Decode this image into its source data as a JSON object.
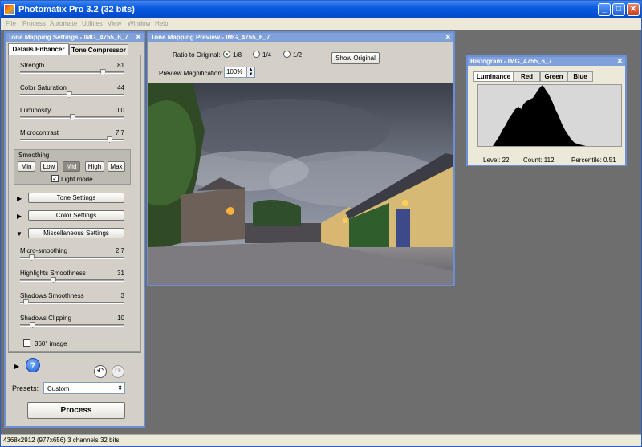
{
  "window": {
    "title": "Photomatix Pro 3.2 (32 bits)"
  },
  "menu": [
    "File",
    "Process",
    "Automate",
    "Utilities",
    "View",
    "Window",
    "Help"
  ],
  "settings_panel": {
    "title": "Tone Mapping Settings - IMG_4755_6_7",
    "tabs": [
      "Details Enhancer",
      "Tone Compressor"
    ],
    "sliders": [
      {
        "label": "Strength",
        "value": "81",
        "level": 0.81
      },
      {
        "label": "Color Saturation",
        "value": "44",
        "level": 0.47
      },
      {
        "label": "Luminosity",
        "value": "0.0",
        "level": 0.5
      },
      {
        "label": "Microcontrast",
        "value": "7.7",
        "level": 0.88
      }
    ],
    "smoothing": {
      "label": "Smoothing",
      "options": [
        "Min",
        "Low",
        "Mid",
        "High",
        "Max"
      ],
      "selected": "Mid",
      "light_mode": "Light mode"
    },
    "sections": [
      "Tone Settings",
      "Color Settings",
      "Miscellaneous Settings"
    ],
    "misc_sliders": [
      {
        "label": "Micro-smoothing",
        "value": "2.7",
        "level": 0.09
      },
      {
        "label": "Highlights Smoothness",
        "value": "31",
        "level": 0.31
      },
      {
        "label": "Shadows Smoothness",
        "value": "3",
        "level": 0.03
      },
      {
        "label": "Shadows Clipping",
        "value": "10",
        "level": 0.1
      }
    ],
    "image360": "360° image",
    "presets_label": "Presets:",
    "preset_value": "Custom",
    "process_label": "Process"
  },
  "preview_panel": {
    "title": "Tone Mapping Preview - IMG_4755_6_7",
    "ratio_label": "Ratio to Original:",
    "ratios": [
      "1/8",
      "1/4",
      "1/2"
    ],
    "ratio_selected": "1/8",
    "show_original": "Show Original",
    "magnification_label": "Preview Magnification:",
    "magnification_value": "100%"
  },
  "histogram_panel": {
    "title": "Histogram - IMG_4755_6_7",
    "tabs": [
      "Luminance",
      "Red",
      "Green",
      "Blue"
    ],
    "level": "Level: 22",
    "count": "Count: 112",
    "percentile": "Percentile: 0.51"
  },
  "status": "4368x2912 (977x656) 3 channels 32 bits"
}
